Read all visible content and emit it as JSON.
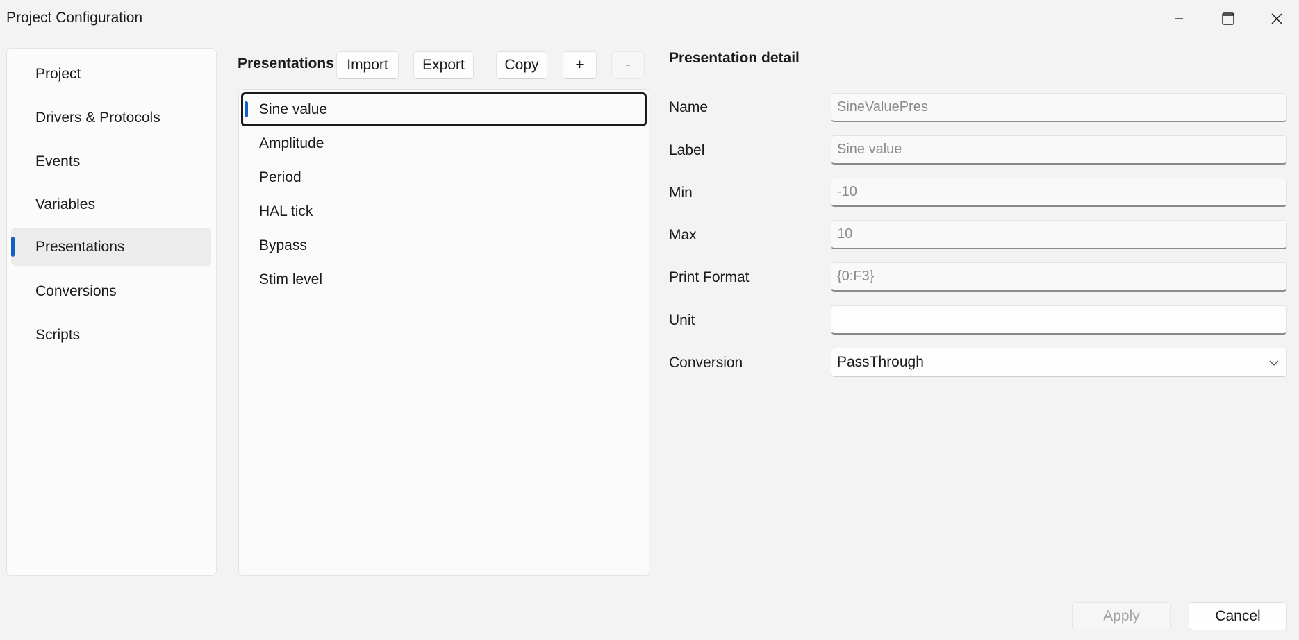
{
  "window": {
    "title": "Project Configuration"
  },
  "nav": {
    "items": [
      {
        "label": "Project"
      },
      {
        "label": "Drivers & Protocols"
      },
      {
        "label": "Events"
      },
      {
        "label": "Variables"
      },
      {
        "label": "Presentations",
        "selected": true
      },
      {
        "label": "Conversions"
      },
      {
        "label": "Scripts"
      }
    ]
  },
  "presentations": {
    "title": "Presentations",
    "toolbar": {
      "import_label": "Import",
      "export_label": "Export",
      "copy_label": "Copy",
      "add_label": "+",
      "remove_label": "-"
    },
    "items": [
      {
        "label": "Sine value",
        "selected": true
      },
      {
        "label": "Amplitude"
      },
      {
        "label": "Period"
      },
      {
        "label": "HAL tick"
      },
      {
        "label": "Bypass"
      },
      {
        "label": "Stim level"
      }
    ]
  },
  "detail": {
    "title": "Presentation detail",
    "fields": {
      "name": {
        "label": "Name",
        "value": "SineValuePres"
      },
      "label": {
        "label": "Label",
        "value": "Sine value"
      },
      "min": {
        "label": "Min",
        "value": "-10"
      },
      "max": {
        "label": "Max",
        "value": "10"
      },
      "print_format": {
        "label": "Print Format",
        "value": "{0:F3}"
      },
      "unit": {
        "label": "Unit",
        "value": ""
      },
      "conversion": {
        "label": "Conversion",
        "value": "PassThrough"
      }
    }
  },
  "footer": {
    "apply_label": "Apply",
    "cancel_label": "Cancel"
  },
  "colors": {
    "accent": "#0f62c3",
    "window_bg": "#f3f3f3",
    "disabled_text": "#a3a3a3"
  }
}
